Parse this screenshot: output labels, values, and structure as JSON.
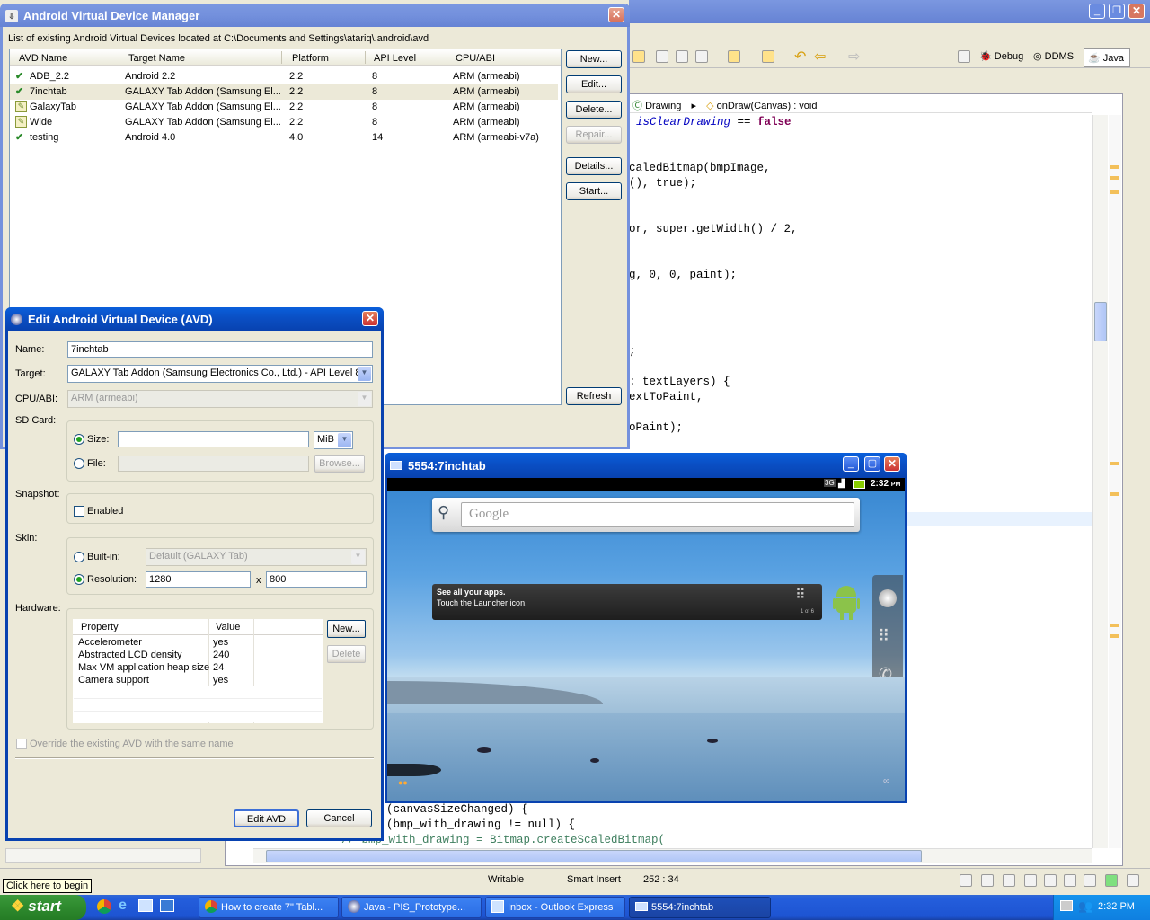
{
  "eclipse": {
    "toolbar": {
      "debug": "Debug",
      "ddms": "DDMS",
      "java": "Java"
    },
    "breadcrumb": {
      "class": "Drawing",
      "method": "onDraw(Canvas) : void"
    },
    "code_lines": [
      {
        "kw": "",
        "it": "isClearDrawing",
        "rest": " == ",
        "kw2": "false"
      },
      {
        "text": "caledBitmap(bmpImage,"
      },
      {
        "text": "(), true);"
      },
      {
        "text": "or, super.getWidth() / 2,"
      },
      {
        "text": "g, 0, 0, paint);"
      },
      {
        "text": ";"
      },
      {
        "text": ": textLayers) {"
      },
      {
        "text": "extToPaint,"
      },
      {
        "text": "oPaint);"
      },
      {
        "text": "(canvasSizeChanged) {"
      },
      {
        "text": "(bmp_with_drawing != null) {"
      },
      {
        "text": "// bmp_with_drawing = Bitmap.createScaledBitmap("
      }
    ],
    "status": {
      "writable": "Writable",
      "insert": "Smart Insert",
      "position": "252 : 34"
    },
    "tooltip": "Click here to begin"
  },
  "avdm": {
    "title": "Android Virtual Device Manager",
    "path_label": "List of existing Android Virtual Devices located at C:\\Documents and Settings\\atariq\\.android\\avd",
    "columns": [
      "AVD Name",
      "Target Name",
      "Platform",
      "API Level",
      "CPU/ABI"
    ],
    "rows": [
      {
        "name": "ADB_2.2",
        "target": "Android 2.2",
        "platform": "2.2",
        "api": "8",
        "cpu": "ARM (armeabi)",
        "status": "ok"
      },
      {
        "name": "7inchtab",
        "target": "GALAXY Tab Addon (Samsung El...",
        "platform": "2.2",
        "api": "8",
        "cpu": "ARM (armeabi)",
        "status": "ok"
      },
      {
        "name": "GalaxyTab",
        "target": "GALAXY Tab Addon (Samsung El...",
        "platform": "2.2",
        "api": "8",
        "cpu": "ARM (armeabi)",
        "status": "warn"
      },
      {
        "name": "Wide",
        "target": "GALAXY Tab Addon (Samsung El...",
        "platform": "2.2",
        "api": "8",
        "cpu": "ARM (armeabi)",
        "status": "warn"
      },
      {
        "name": "testing",
        "target": "Android 4.0",
        "platform": "4.0",
        "api": "14",
        "cpu": "ARM (armeabi-v7a)",
        "status": "ok"
      }
    ],
    "buttons": {
      "new": "New...",
      "edit": "Edit...",
      "delete": "Delete...",
      "repair": "Repair...",
      "details": "Details...",
      "start": "Start...",
      "refresh": "Refresh"
    }
  },
  "edit": {
    "title": "Edit Android Virtual Device (AVD)",
    "name_label": "Name:",
    "name_value": "7inchtab",
    "target_label": "Target:",
    "target_value": "GALAXY Tab Addon (Samsung Electronics Co., Ltd.) - API Level 8",
    "cpu_label": "CPU/ABI:",
    "cpu_value": "ARM (armeabi)",
    "sd_label": "SD Card:",
    "size_label": "Size:",
    "size_value": "",
    "size_unit": "MiB",
    "file_label": "File:",
    "browse": "Browse...",
    "snapshot_label": "Snapshot:",
    "enabled_label": "Enabled",
    "skin_label": "Skin:",
    "builtin_label": "Built-in:",
    "builtin_value": "Default (GALAXY Tab)",
    "resolution_label": "Resolution:",
    "res_w": "1280",
    "res_x": "x",
    "res_h": "800",
    "hardware_label": "Hardware:",
    "hw_columns": [
      "Property",
      "Value"
    ],
    "hw_rows": [
      {
        "prop": "Accelerometer",
        "val": "yes"
      },
      {
        "prop": "Abstracted LCD density",
        "val": "240"
      },
      {
        "prop": "Max VM application heap size",
        "val": "24"
      },
      {
        "prop": "Camera support",
        "val": "yes"
      }
    ],
    "hw_new": "New...",
    "hw_delete": "Delete",
    "override_label": "Override the existing AVD with the same name",
    "edit_btn": "Edit AVD",
    "cancel_btn": "Cancel"
  },
  "emulator": {
    "title": "5554:7inchtab",
    "net": "3G",
    "time": "2:32",
    "ampm": "PM",
    "search_placeholder": "Google",
    "tip_title": "See all your apps.",
    "tip_body": "Touch the Launcher icon.",
    "tip_page": "1 of 6"
  },
  "taskbar": {
    "start": "start",
    "tasks": [
      "How to create 7\" Tabl...",
      "Java - PIS_Prototype...",
      "Inbox - Outlook Express",
      "5554:7inchtab"
    ],
    "clock": "2:32 PM"
  }
}
